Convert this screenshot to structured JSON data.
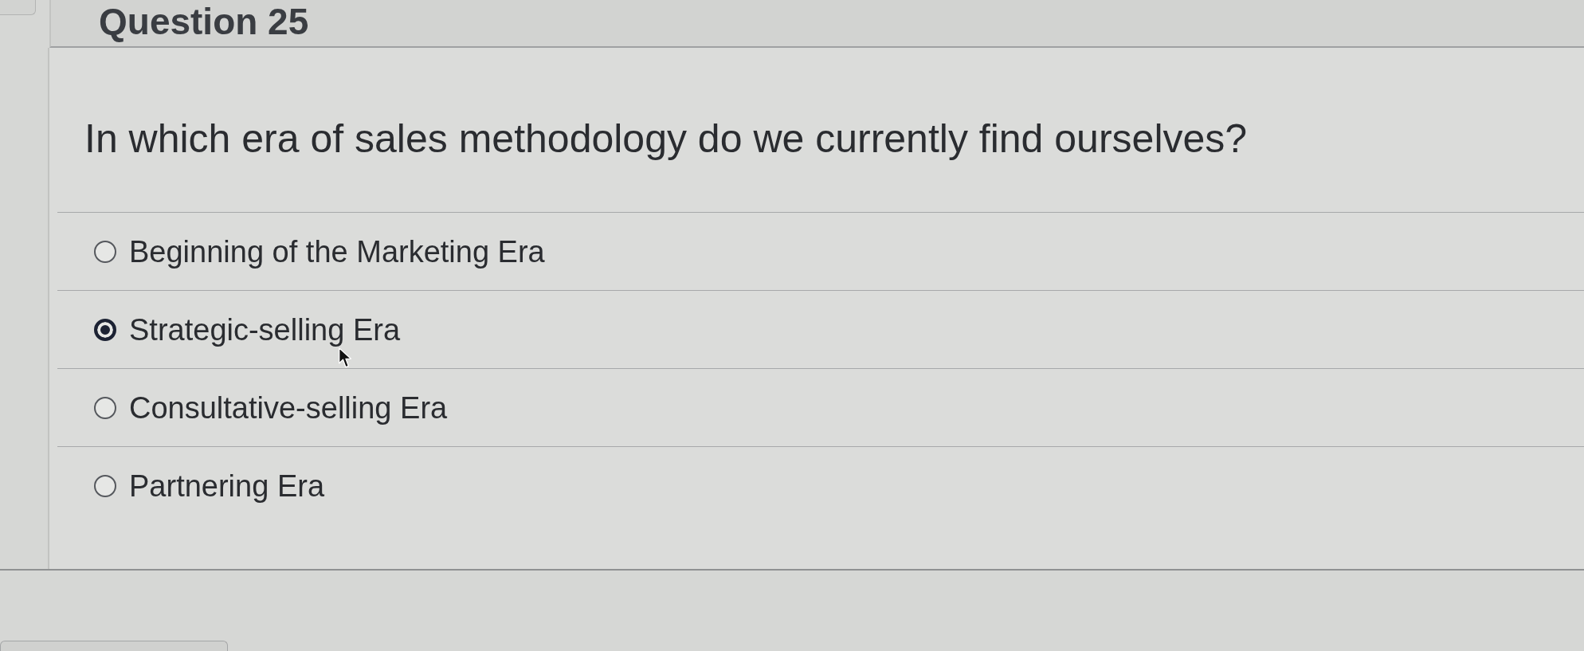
{
  "header": {
    "title": "Question 25"
  },
  "question": {
    "text": "In which era of sales methodology do we currently find ourselves?"
  },
  "options": [
    {
      "label": "Beginning of the Marketing Era",
      "selected": false
    },
    {
      "label": "Strategic-selling Era",
      "selected": true
    },
    {
      "label": "Consultative-selling Era",
      "selected": false
    },
    {
      "label": "Partnering Era",
      "selected": false
    }
  ]
}
